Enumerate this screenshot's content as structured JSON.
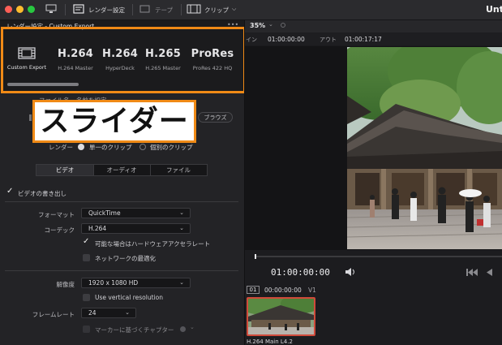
{
  "toolbar": {
    "render_settings_label": "レンダー設定",
    "tape_label": "テープ",
    "clips_label": "クリップ",
    "app_title": "Unt"
  },
  "render_panel": {
    "header_title": "レンダー設定 - Custom Export",
    "more_label": "•••",
    "presets": [
      {
        "title": "",
        "subtitle": "Custom Export"
      },
      {
        "title": "H.264",
        "subtitle": "H.264 Master"
      },
      {
        "title": "H.264",
        "subtitle": "HyperDeck"
      },
      {
        "title": "H.265",
        "subtitle": "H.265 Master"
      },
      {
        "title": "ProRes",
        "subtitle": "ProRes 422 HQ"
      }
    ],
    "filename_row_partial": "ファイル名",
    "filename_row_suffix": "名前を設定",
    "browse_label": "ブラウズ",
    "render_label": "レンダー",
    "single_clip_label": "単一のクリップ",
    "individual_clips_label": "個別のクリップ",
    "tabs": [
      "ビデオ",
      "オーディオ",
      "ファイル"
    ],
    "export_video_label": "ビデオの書き出し",
    "format_label": "フォーマット",
    "format_value": "QuickTime",
    "codec_label": "コーデック",
    "codec_value": "H.264",
    "hw_accel_label": "可能な場合はハードウェアアクセラレート",
    "network_opt_label": "ネットワークの最適化",
    "resolution_label": "解像度",
    "resolution_value": "1920 x 1080 HD",
    "vertical_res_label": "Use vertical resolution",
    "framerate_label": "フレームレート",
    "framerate_value": "24",
    "chapters_label": "マーカーに基づくチャプター"
  },
  "annotation": {
    "overlay_text": "スライダー",
    "color": "#f08a16"
  },
  "viewer": {
    "zoom_label": "35%",
    "in_label": "イン",
    "in_tc": "01:00:00:00",
    "out_label": "アウト",
    "out_tc": "01:00:17:17",
    "timecode": "01:00:00:00"
  },
  "clips": {
    "index_label": "01",
    "clip_tc": "00:00:00:00",
    "track_label": "V1",
    "clip_name": "H.264 Main L4.2"
  },
  "icons": [
    "apple-dots",
    "render-settings-icon",
    "tape-icon",
    "clip-icon",
    "speaker-icon",
    "skip-back-icon",
    "play-back-icon"
  ]
}
